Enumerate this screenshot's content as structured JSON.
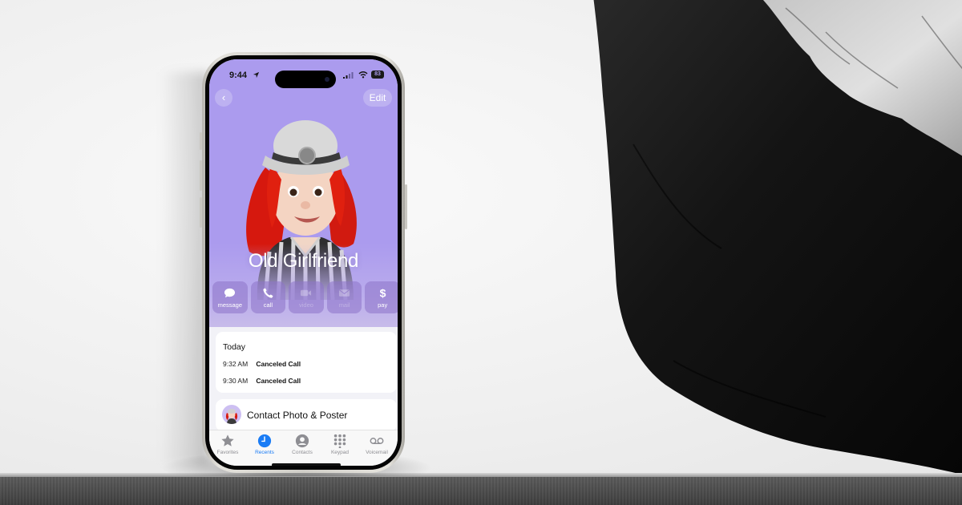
{
  "status_bar": {
    "time": "9:44",
    "battery": "83",
    "icons": [
      "location-arrow-icon",
      "cellular-signal-icon",
      "wifi-icon",
      "battery-icon"
    ]
  },
  "nav": {
    "back_icon": "chevron-left-icon",
    "back_glyph": "‹",
    "edit_label": "Edit"
  },
  "contact": {
    "name": "Old Girlfriend",
    "poster_background": "#ab9bee"
  },
  "actions": [
    {
      "label": "message",
      "icon": "message-bubble-icon",
      "enabled": true
    },
    {
      "label": "call",
      "icon": "phone-icon",
      "enabled": true
    },
    {
      "label": "video",
      "icon": "video-camera-icon",
      "enabled": false
    },
    {
      "label": "mail",
      "icon": "envelope-icon",
      "enabled": false
    },
    {
      "label": "pay",
      "icon": "dollar-icon",
      "enabled": true
    }
  ],
  "recents": {
    "heading": "Today",
    "items": [
      {
        "time": "9:32 AM",
        "label": "Canceled Call"
      },
      {
        "time": "9:30 AM",
        "label": "Canceled Call"
      }
    ]
  },
  "contact_photo_poster": {
    "label": "Contact Photo & Poster"
  },
  "tabbar": {
    "active": "Recents",
    "active_color": "#1a7cf5",
    "tabs": [
      {
        "label": "Favorites",
        "icon": "star-icon"
      },
      {
        "label": "Recents",
        "icon": "clock-icon"
      },
      {
        "label": "Contacts",
        "icon": "person-circle-icon"
      },
      {
        "label": "Keypad",
        "icon": "keypad-grid-icon"
      },
      {
        "label": "Voicemail",
        "icon": "voicemail-icon"
      }
    ]
  }
}
